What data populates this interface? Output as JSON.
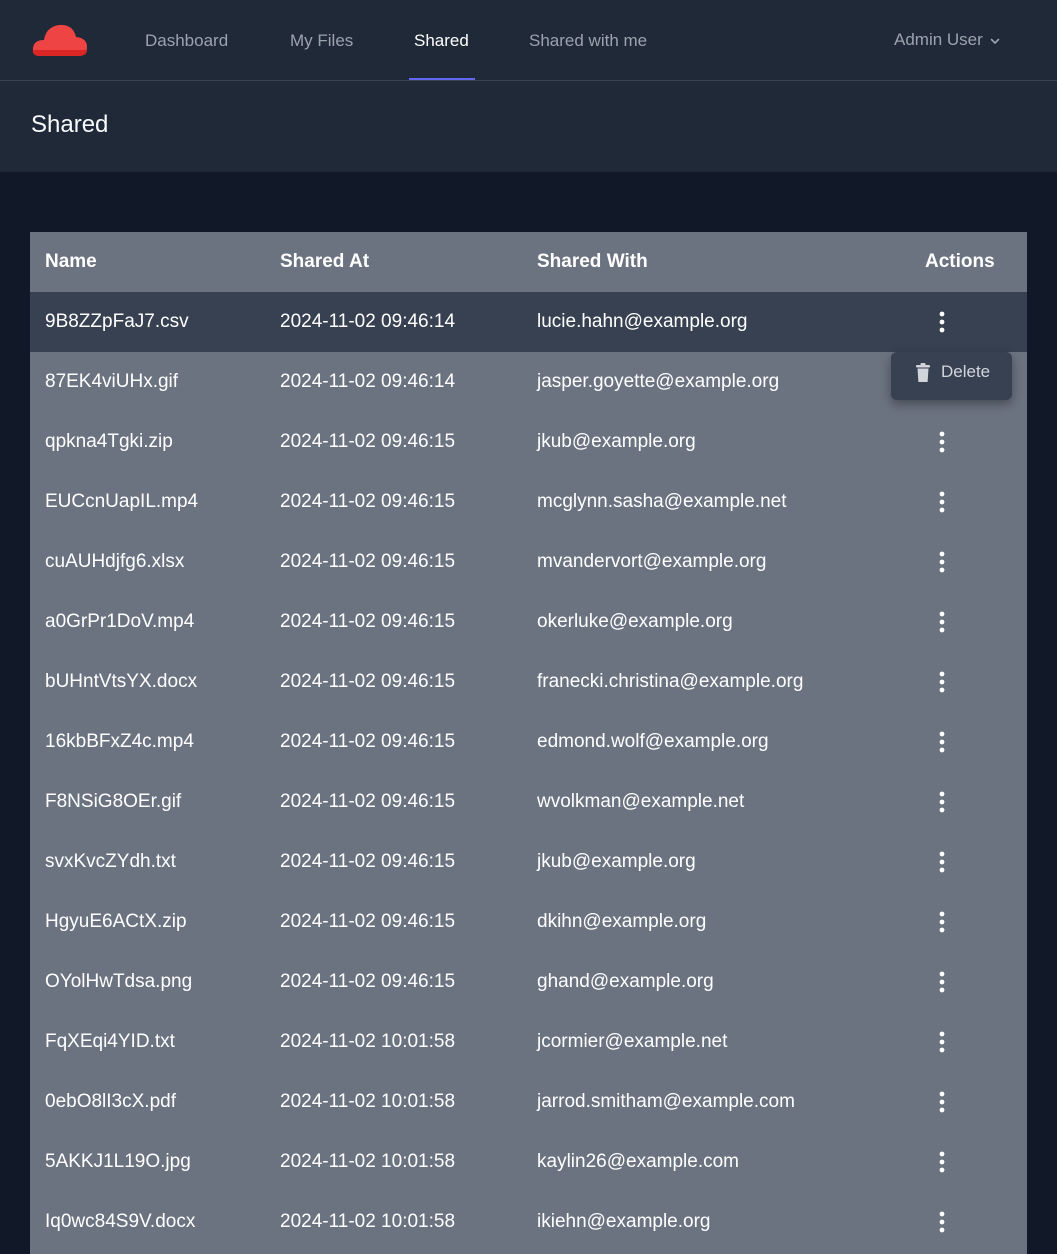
{
  "nav": {
    "links": [
      "Dashboard",
      "My Files",
      "Shared",
      "Shared with me"
    ],
    "active": "Shared",
    "user": "Admin User",
    "logo_color": "#ef4444",
    "accent": "#6366f1"
  },
  "page": {
    "title": "Shared"
  },
  "table": {
    "headers": {
      "name": "Name",
      "shared_at": "Shared At",
      "shared_with": "Shared With",
      "actions": "Actions"
    },
    "rows": [
      {
        "name": "9B8ZZpFaJ7.csv",
        "shared_at": "2024-11-02 09:46:14",
        "shared_with": "lucie.hahn@example.org"
      },
      {
        "name": "87EK4viUHx.gif",
        "shared_at": "2024-11-02 09:46:14",
        "shared_with": "jasper.goyette@example.org"
      },
      {
        "name": "qpkna4Tgki.zip",
        "shared_at": "2024-11-02 09:46:15",
        "shared_with": "jkub@example.org"
      },
      {
        "name": "EUCcnUapIL.mp4",
        "shared_at": "2024-11-02 09:46:15",
        "shared_with": "mcglynn.sasha@example.net"
      },
      {
        "name": "cuAUHdjfg6.xlsx",
        "shared_at": "2024-11-02 09:46:15",
        "shared_with": "mvandervort@example.org"
      },
      {
        "name": "a0GrPr1DoV.mp4",
        "shared_at": "2024-11-02 09:46:15",
        "shared_with": "okerluke@example.org"
      },
      {
        "name": "bUHntVtsYX.docx",
        "shared_at": "2024-11-02 09:46:15",
        "shared_with": "franecki.christina@example.org"
      },
      {
        "name": "16kbBFxZ4c.mp4",
        "shared_at": "2024-11-02 09:46:15",
        "shared_with": "edmond.wolf@example.org"
      },
      {
        "name": "F8NSiG8OEr.gif",
        "shared_at": "2024-11-02 09:46:15",
        "shared_with": "wvolkman@example.net"
      },
      {
        "name": "svxKvcZYdh.txt",
        "shared_at": "2024-11-02 09:46:15",
        "shared_with": "jkub@example.org"
      },
      {
        "name": "HgyuE6ACtX.zip",
        "shared_at": "2024-11-02 09:46:15",
        "shared_with": "dkihn@example.org"
      },
      {
        "name": "OYolHwTdsa.png",
        "shared_at": "2024-11-02 09:46:15",
        "shared_with": "ghand@example.org"
      },
      {
        "name": "FqXEqi4YID.txt",
        "shared_at": "2024-11-02 10:01:58",
        "shared_with": "jcormier@example.net"
      },
      {
        "name": "0ebO8lI3cX.pdf",
        "shared_at": "2024-11-02 10:01:58",
        "shared_with": "jarrod.smitham@example.com"
      },
      {
        "name": "5AKKJ1L19O.jpg",
        "shared_at": "2024-11-02 10:01:58",
        "shared_with": "kaylin26@example.com"
      },
      {
        "name": "Iq0wc84S9V.docx",
        "shared_at": "2024-11-02 10:01:58",
        "shared_with": "ikiehn@example.org"
      }
    ],
    "hover_row": 0,
    "dropdown_row": 1
  },
  "dropdown": {
    "items": [
      "Delete"
    ],
    "icon": "trash-icon"
  }
}
